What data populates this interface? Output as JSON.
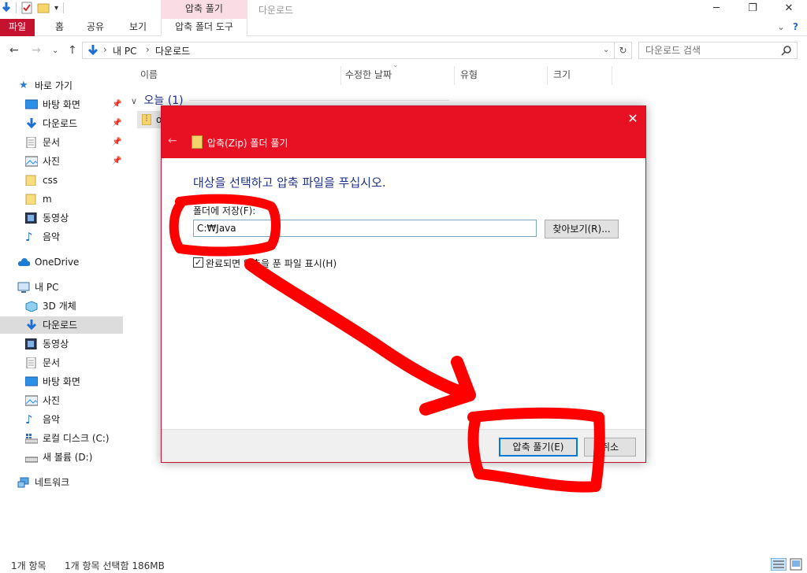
{
  "titlebar": {
    "context_group": "압축 풀기",
    "window_title": "다운로드"
  },
  "ribbon": {
    "tabs": [
      "파일",
      "홈",
      "공유",
      "보기"
    ],
    "context_tab": "압축 폴더 도구"
  },
  "address": {
    "crumbs": [
      "내 PC",
      "다운로드"
    ],
    "search_placeholder": "다운로드 검색"
  },
  "sidebar": {
    "quick_access": "바로 가기",
    "quick_items": [
      "바탕 화면",
      "다운로드",
      "문서",
      "사진",
      "css",
      "m",
      "동영상",
      "음악"
    ],
    "onedrive": "OneDrive",
    "this_pc": "내 PC",
    "pc_items": [
      "3D 개체",
      "다운로드",
      "동영상",
      "문서",
      "바탕 화면",
      "사진",
      "음악",
      "로컬 디스크 (C:)",
      "새 볼륨 (D:)"
    ],
    "network": "네트워크"
  },
  "columns": [
    "이름",
    "수정한 날짜",
    "유형",
    "크기"
  ],
  "group_label": "오늘 (1)",
  "file_row_text": "o",
  "status": {
    "count": "1개 항목",
    "selected": "1개 항목 선택함 186MB"
  },
  "dialog": {
    "title": "압축(Zip) 폴더 풀기",
    "heading": "대상을 선택하고 압축 파일을 푸십시오.",
    "label": "폴더에 저장(F):",
    "path_value": "C:₩Java",
    "browse": "찾아보기(R)...",
    "checkbox_label": "완료되면 압축을 푼 파일 표시(H)",
    "checkbox_checked": true,
    "ok": "압축 풀기(E)",
    "cancel": "취소"
  },
  "colors": {
    "accent": "#e81123",
    "file_tab": "#c4122f",
    "annotation": "#ff0000",
    "heading": "#1e3287"
  }
}
